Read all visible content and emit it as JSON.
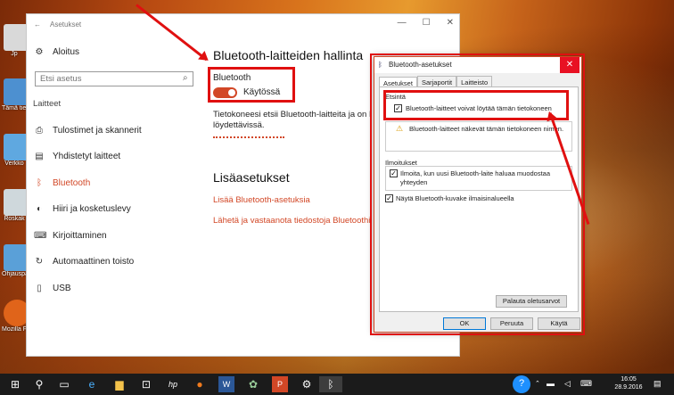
{
  "desktop": {
    "icons": [
      {
        "label": "Jp",
        "color": "#d9d9d9"
      },
      {
        "label": "Tämä tietoko",
        "color": "#4d90d0"
      },
      {
        "label": "Verkko",
        "color": "#5fa8e0"
      },
      {
        "label": "Roskak",
        "color": "#cfd8dc"
      },
      {
        "label": "Ohjauspa",
        "color": "#5aa0d8"
      },
      {
        "label": "Mozilla Firefox",
        "color": "#e0641a"
      }
    ]
  },
  "settings": {
    "window_title": "Asetukset",
    "back": "←",
    "window_controls": [
      "—",
      "☐",
      "✕"
    ],
    "home": "Aloitus",
    "search_placeholder": "Etsi asetus",
    "group": "Laitteet",
    "nav": [
      {
        "label": "Tulostimet ja skannerit",
        "icon": "printer-icon",
        "glyph": "⎙"
      },
      {
        "label": "Yhdistetyt laitteet",
        "icon": "devices-icon",
        "glyph": "▤"
      },
      {
        "label": "Bluetooth",
        "icon": "bluetooth-icon",
        "glyph": "ᛒ"
      },
      {
        "label": "Hiiri ja kosketuslevy",
        "icon": "mouse-icon",
        "glyph": "◐"
      },
      {
        "label": "Kirjoittaminen",
        "icon": "keyboard-icon",
        "glyph": "⌨"
      },
      {
        "label": "Automaattinen toisto",
        "icon": "autoplay-icon",
        "glyph": "↻"
      },
      {
        "label": "USB",
        "icon": "usb-icon",
        "glyph": "▯"
      }
    ],
    "heading": "Bluetooth-laitteiden hallinta",
    "bt_label": "Bluetooth",
    "toggle_state": "Käytössä",
    "desc_line1": "Tietokoneesi etsii Bluetooth-laitteita ja on Blu",
    "desc_line2": "löydettävissä.",
    "more_heading": "Lisäasetukset",
    "link1": "Lisää Bluetooth-asetuksia",
    "link2": "Lähetä ja vastaanota tiedostoja Bluetoothin k"
  },
  "dialog": {
    "title": "Bluetooth-asetukset",
    "tabs": [
      "Asetukset",
      "Sarjaportit",
      "Laitteisto"
    ],
    "discovery_heading": "Etsintä",
    "discovery_option": "Bluetooth-laitteet voivat löytää tämän tietokoneen",
    "discovery_checked": true,
    "warning": "Bluetooth-laitteet näkevät tämän tietokoneen nimen.",
    "notify_heading": "Ilmoitukset",
    "notify_line1": "Ilmoita, kun uusi Bluetooth-laite haluaa muodostaa",
    "notify_line2": "yhteyden",
    "notify_checked": true,
    "tray_option": "Näytä Bluetooth-kuvake ilmaisinalueella",
    "tray_checked": true,
    "restore_button": "Palauta oletusarvot",
    "ok": "OK",
    "cancel": "Peruuta",
    "apply": "Käytä"
  },
  "taskbar": {
    "time": "16:05",
    "date": "28.9.2016"
  },
  "colors": {
    "accent": "#d24726",
    "highlight_red": "#e01010"
  }
}
